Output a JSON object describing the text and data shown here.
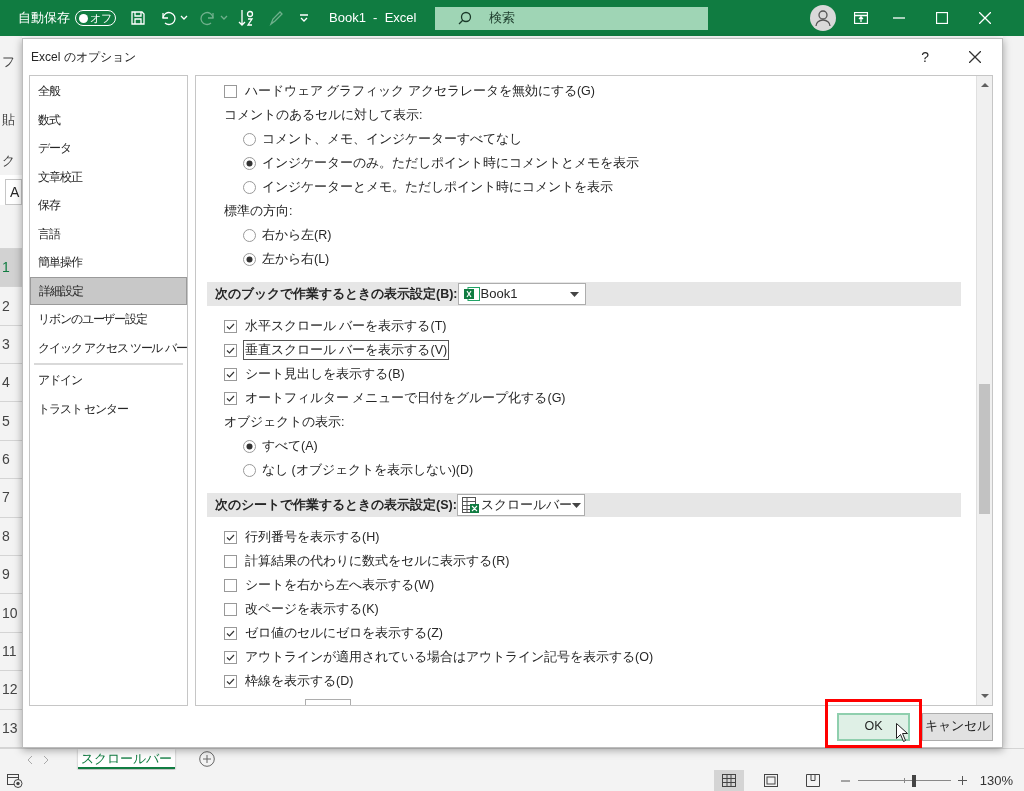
{
  "app_bar": {
    "autosave_label": "自動保存",
    "autosave_toggle": {
      "label": "オフ",
      "on": false
    },
    "document_title": "Book1  -  Excel",
    "search": {
      "placeholder": "検索"
    }
  },
  "background_sheet": {
    "ribbon_fragments": [
      "フ",
      "貼",
      "ク"
    ],
    "name_box": "A",
    "row_headers": [
      {
        "label": "1",
        "selected": true
      },
      {
        "label": "2",
        "selected": false
      },
      {
        "label": "3",
        "selected": false
      },
      {
        "label": "4",
        "selected": false
      },
      {
        "label": "5",
        "selected": false
      },
      {
        "label": "6",
        "selected": false
      },
      {
        "label": "7",
        "selected": false
      },
      {
        "label": "8",
        "selected": false
      },
      {
        "label": "9",
        "selected": false
      },
      {
        "label": "10",
        "selected": false
      },
      {
        "label": "11",
        "selected": false
      },
      {
        "label": "12",
        "selected": false
      },
      {
        "label": "13",
        "selected": false
      }
    ]
  },
  "dialog": {
    "title": "Excel のオプション",
    "help": "?",
    "sidebar": {
      "items": [
        {
          "label": "全般",
          "selected": false,
          "separator_after": false
        },
        {
          "label": "数式",
          "selected": false,
          "separator_after": false
        },
        {
          "label": "データ",
          "selected": false,
          "separator_after": false
        },
        {
          "label": "文章校正",
          "selected": false,
          "separator_after": false
        },
        {
          "label": "保存",
          "selected": false,
          "separator_after": false
        },
        {
          "label": "言語",
          "selected": false,
          "separator_after": false
        },
        {
          "label": "簡単操作",
          "selected": false,
          "separator_after": false
        },
        {
          "label": "詳細設定",
          "selected": true,
          "separator_after": false
        },
        {
          "label": "リボンのユーザー設定",
          "selected": false,
          "separator_after": false
        },
        {
          "label": "クイック アクセス ツール バー",
          "selected": false,
          "separator_after": true
        },
        {
          "label": "アドイン",
          "selected": false,
          "separator_after": false
        },
        {
          "label": "トラスト センター",
          "selected": false,
          "separator_after": false
        }
      ]
    },
    "rows": [
      {
        "kind": "checkbox",
        "label": "ハードウェア グラフィック アクセラレータを無効にする(G)",
        "checked": false,
        "focused": false
      },
      {
        "kind": "label",
        "label": "コメントのあるセルに対して表示:"
      },
      {
        "kind": "radio",
        "label": "コメント、メモ、インジケーターすべてなし",
        "selected": false
      },
      {
        "kind": "radio",
        "label": "インジケーターのみ。ただしポイント時にコメントとメモを表示",
        "selected": true
      },
      {
        "kind": "radio",
        "label": "インジケーターとメモ。ただしポイント時にコメントを表示",
        "selected": false
      },
      {
        "kind": "label",
        "label": "標準の方向:"
      },
      {
        "kind": "radio",
        "label": "右から左(R)",
        "selected": false
      },
      {
        "kind": "radio",
        "label": "左から右(L)",
        "selected": true
      },
      {
        "kind": "section",
        "label": "次のブックで作業するときの表示設定(B):",
        "dropdown": {
          "value": "Book1"
        }
      },
      {
        "kind": "checkbox",
        "label": "水平スクロール バーを表示する(T)",
        "checked": true,
        "focused": false
      },
      {
        "kind": "checkbox",
        "label": "垂直スクロール バーを表示する(V)",
        "checked": true,
        "focused": true
      },
      {
        "kind": "checkbox",
        "label": "シート見出しを表示する(B)",
        "checked": true,
        "focused": false
      },
      {
        "kind": "checkbox",
        "label": "オートフィルター メニューで日付をグループ化する(G)",
        "checked": true,
        "focused": false
      },
      {
        "kind": "label",
        "label": "オブジェクトの表示:"
      },
      {
        "kind": "radio",
        "label": "すべて(A)",
        "selected": true
      },
      {
        "kind": "radio",
        "label": "なし (オブジェクトを表示しない)(D)",
        "selected": false
      },
      {
        "kind": "section",
        "label": "次のシートで作業するときの表示設定(S):",
        "dropdown": {
          "value": "スクロールバー"
        }
      },
      {
        "kind": "checkbox",
        "label": "行列番号を表示する(H)",
        "checked": true,
        "focused": false
      },
      {
        "kind": "checkbox",
        "label": "計算結果の代わりに数式をセルに表示する(R)",
        "checked": false,
        "focused": false
      },
      {
        "kind": "checkbox",
        "label": "シートを右から左へ表示する(W)",
        "checked": false,
        "focused": false
      },
      {
        "kind": "checkbox",
        "label": "改ページを表示する(K)",
        "checked": false,
        "focused": false
      },
      {
        "kind": "checkbox",
        "label": "ゼロ値のセルにゼロを表示する(Z)",
        "checked": true,
        "focused": false
      },
      {
        "kind": "checkbox",
        "label": "アウトラインが適用されている場合はアウトライン記号を表示する(O)",
        "checked": true,
        "focused": false
      },
      {
        "kind": "checkbox",
        "label": "枠線を表示する(D)",
        "checked": true,
        "focused": false
      }
    ],
    "buttons": [
      {
        "label": "OK",
        "default": true,
        "highlighted": true
      },
      {
        "label": "キャンセル",
        "default": false,
        "highlighted": false
      }
    ]
  },
  "sheet_tabs": [
    {
      "label": "スクロールバー",
      "selected": true
    }
  ],
  "status_bar": {
    "views": [
      {
        "kind": "normal",
        "selected": true
      },
      {
        "kind": "layout",
        "selected": false
      },
      {
        "kind": "pagebreak",
        "selected": false
      }
    ],
    "zoom": {
      "level": 0.6,
      "reading": "130%"
    }
  }
}
